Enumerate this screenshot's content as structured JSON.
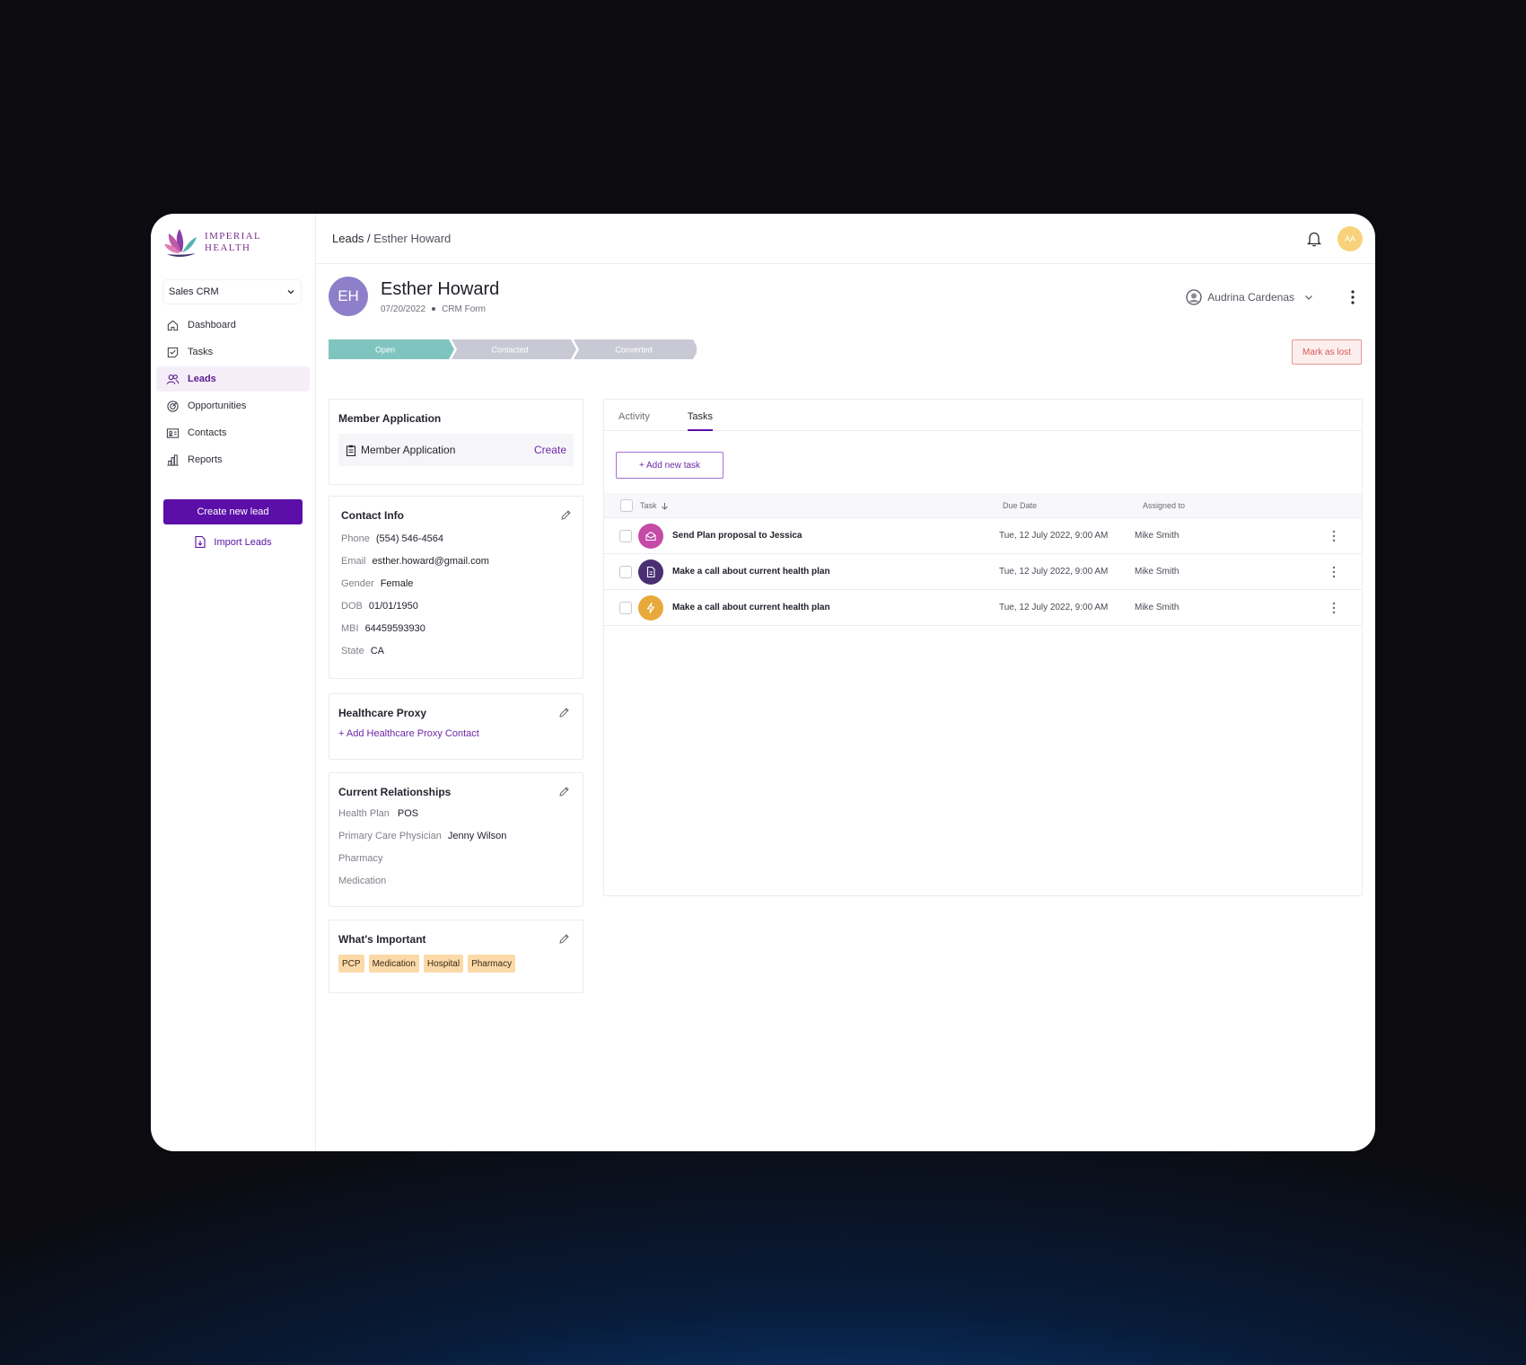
{
  "brand": {
    "line1": "Imperial",
    "line2": "Health"
  },
  "sidebar": {
    "select_value": "Sales CRM",
    "items": [
      {
        "label": "Dashboard",
        "icon": "home-icon"
      },
      {
        "label": "Tasks",
        "icon": "task-icon"
      },
      {
        "label": "Leads",
        "icon": "users-icon",
        "active": true
      },
      {
        "label": "Opportunities",
        "icon": "target-icon"
      },
      {
        "label": "Contacts",
        "icon": "contact-card-icon"
      },
      {
        "label": "Reports",
        "icon": "bar-chart-icon"
      }
    ],
    "create_label": "Create new lead",
    "import_label": "Import Leads"
  },
  "header": {
    "breadcrumb_root": "Leads",
    "breadcrumb_sep": "/",
    "breadcrumb_current": "Esther Howard",
    "user_initials": "AA"
  },
  "lead": {
    "initials": "EH",
    "name": "Esther Howard",
    "date": "07/20/2022",
    "source": "CRM Form",
    "owner": "Audrina Cardenas",
    "stages": [
      "Open",
      "Contacted",
      "Converted"
    ],
    "active_stage": "Open",
    "mark_lost_label": "Mark as lost"
  },
  "member_application": {
    "title": "Member Application",
    "item": "Member Application",
    "action": "Create"
  },
  "contact_info": {
    "title": "Contact Info",
    "fields": [
      {
        "k": "Phone",
        "v": "(554) 546-4564"
      },
      {
        "k": "Email",
        "v": "esther.howard@gmail.com"
      },
      {
        "k": "Gender",
        "v": "Female"
      },
      {
        "k": "DOB",
        "v": "01/01/1950"
      },
      {
        "k": "MBI",
        "v": "64459593930"
      },
      {
        "k": "State",
        "v": "CA"
      }
    ]
  },
  "healthcare_proxy": {
    "title": "Healthcare Proxy",
    "add_label": "+ Add Healthcare Proxy Contact"
  },
  "relationships": {
    "title": "Current Relationships",
    "fields": [
      {
        "k": "Health Plan",
        "v": "POS"
      },
      {
        "k": "Primary Care Physician",
        "v": "Jenny Wilson"
      },
      {
        "k": "Pharmacy",
        "v": ""
      },
      {
        "k": "Medication",
        "v": ""
      }
    ]
  },
  "important": {
    "title": "What's Important",
    "tags": [
      "PCP",
      "Medication",
      "Hospital",
      "Pharmacy"
    ]
  },
  "tabs": [
    "Activity",
    "Tasks"
  ],
  "active_tab": "Tasks",
  "tasks": {
    "add_label": "+ Add new task",
    "columns": {
      "task": "Task",
      "due": "Due Date",
      "assigned": "Assigned to"
    },
    "rows": [
      {
        "name": "Send Plan proposal to Jessica",
        "due": "Tue, 12 July 2022, 9:00 AM",
        "assigned": "Mike Smith",
        "icon": "mail-open-icon",
        "color": "#c64aa8"
      },
      {
        "name": "Make a call about current health plan",
        "due": "Tue, 12 July 2022, 9:00 AM",
        "assigned": "Mike Smith",
        "icon": "document-icon",
        "color": "#4a2f72"
      },
      {
        "name": "Make a call about current health plan",
        "due": "Tue, 12 July 2022, 9:00 AM",
        "assigned": "Mike Smith",
        "icon": "bolt-icon",
        "color": "#e8a93a"
      }
    ]
  },
  "colors": {
    "brand_purple": "#5b0fa8",
    "stage_active": "#7fc4bf",
    "stage_inactive": "#c9c9d6",
    "lost_red": "#d45858",
    "tag_bg": "#fbd9a8"
  }
}
